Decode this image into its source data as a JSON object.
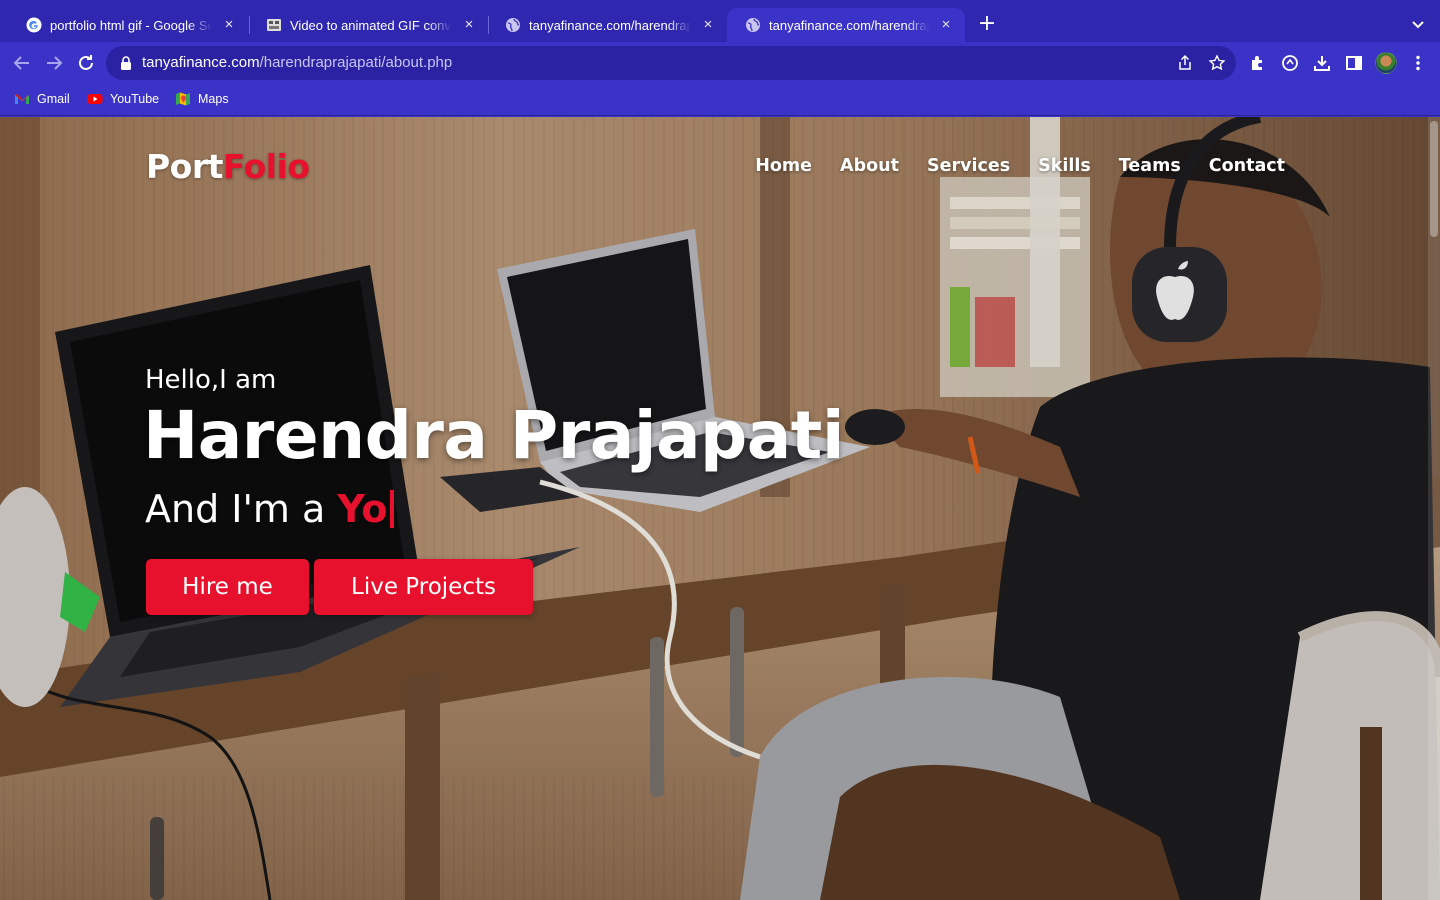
{
  "browser": {
    "tabs": [
      {
        "title": "portfolio html gif - Google Search",
        "favicon": "google-icon",
        "active": false
      },
      {
        "title": "Video to animated GIF converter",
        "favicon": "ezgif-icon",
        "active": false
      },
      {
        "title": "tanyafinance.com/harendraprajapati",
        "favicon": "globe-icon",
        "active": false
      },
      {
        "title": "tanyafinance.com/harendraprajapati",
        "favicon": "globe-icon",
        "active": true
      }
    ],
    "new_tab_label": "+",
    "tab_close_glyph": "×",
    "url_host": "tanyafinance.com",
    "url_path": "/harendraprajapati/about.php",
    "bookmarks": [
      {
        "label": "Gmail",
        "icon": "gmail-icon"
      },
      {
        "label": "YouTube",
        "icon": "youtube-icon"
      },
      {
        "label": "Maps",
        "icon": "maps-icon"
      }
    ]
  },
  "site": {
    "brand_primary": "Port",
    "brand_accent": "Folio",
    "nav": [
      "Home",
      "About",
      "Services",
      "Skills",
      "Teams",
      "Contact"
    ],
    "hero": {
      "greeting": "Hello,I am",
      "name": "Harendra Prajapati",
      "role_prefix": "And I'm a ",
      "role_typed": "Yo"
    },
    "buttons": {
      "hire": "Hire me",
      "projects": "Live Projects"
    }
  },
  "colors": {
    "browser_frame": "#3b33c7",
    "accent_red": "#e8112d"
  }
}
